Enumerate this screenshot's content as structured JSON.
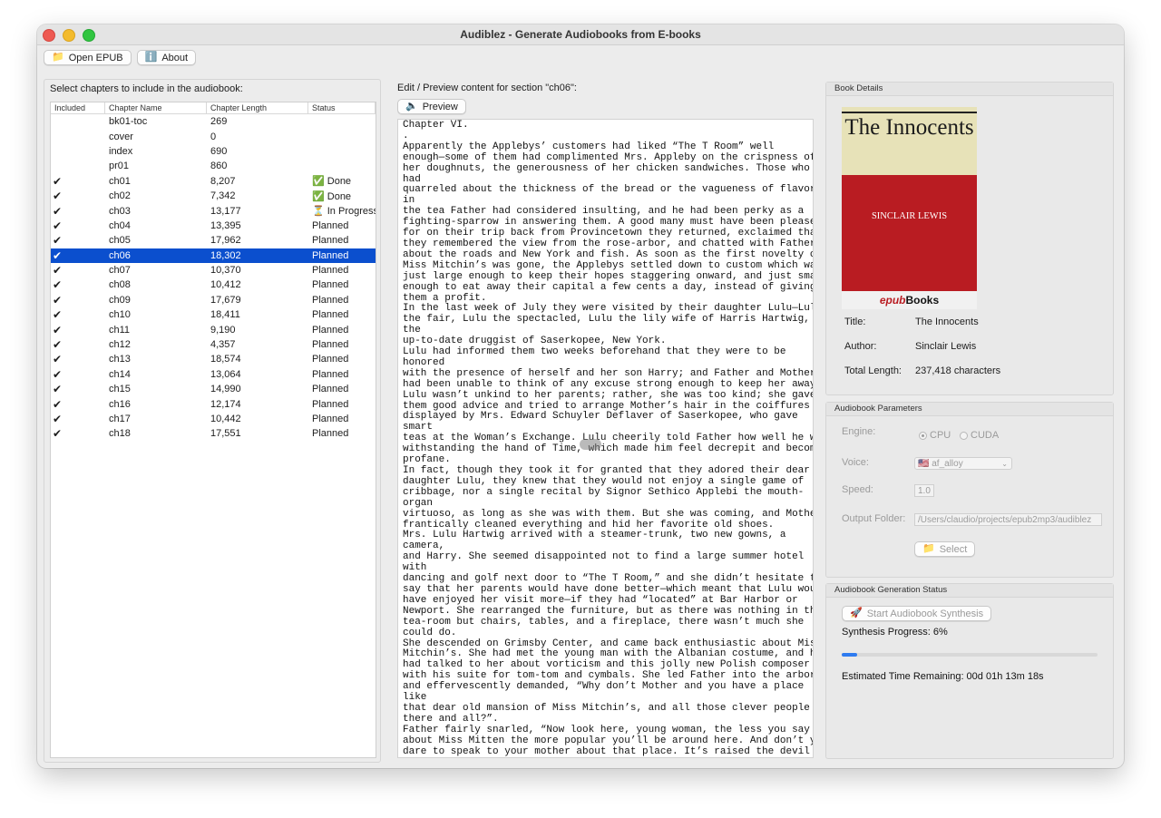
{
  "window": {
    "title": "Audiblez - Generate Audiobooks from E-books"
  },
  "toolbar": {
    "open_label": "Open EPUB",
    "open_icon": "folder-icon",
    "about_label": "About",
    "about_icon": "info-icon"
  },
  "chapters": {
    "prompt": "Select chapters to include in the audiobook:",
    "headers": [
      "Included",
      "Chapter Name",
      "Chapter Length",
      "Status"
    ],
    "rows": [
      {
        "included": "",
        "name": "bk01-toc",
        "length": "269",
        "status": ""
      },
      {
        "included": "",
        "name": "cover",
        "length": "0",
        "status": ""
      },
      {
        "included": "",
        "name": "index",
        "length": "690",
        "status": ""
      },
      {
        "included": "",
        "name": "pr01",
        "length": "860",
        "status": ""
      },
      {
        "included": "✔",
        "name": "ch01",
        "length": "8,207",
        "status": "✅ Done"
      },
      {
        "included": "✔",
        "name": "ch02",
        "length": "7,342",
        "status": "✅ Done"
      },
      {
        "included": "✔",
        "name": "ch03",
        "length": "13,177",
        "status": "⏳ In Progress"
      },
      {
        "included": "✔",
        "name": "ch04",
        "length": "13,395",
        "status": "Planned"
      },
      {
        "included": "✔",
        "name": "ch05",
        "length": "17,962",
        "status": "Planned"
      },
      {
        "included": "✔",
        "name": "ch06",
        "length": "18,302",
        "status": "Planned"
      },
      {
        "included": "✔",
        "name": "ch07",
        "length": "10,370",
        "status": "Planned"
      },
      {
        "included": "✔",
        "name": "ch08",
        "length": "10,412",
        "status": "Planned"
      },
      {
        "included": "✔",
        "name": "ch09",
        "length": "17,679",
        "status": "Planned"
      },
      {
        "included": "✔",
        "name": "ch10",
        "length": "18,411",
        "status": "Planned"
      },
      {
        "included": "✔",
        "name": "ch11",
        "length": "9,190",
        "status": "Planned"
      },
      {
        "included": "✔",
        "name": "ch12",
        "length": "4,357",
        "status": "Planned"
      },
      {
        "included": "✔",
        "name": "ch13",
        "length": "18,574",
        "status": "Planned"
      },
      {
        "included": "✔",
        "name": "ch14",
        "length": "13,064",
        "status": "Planned"
      },
      {
        "included": "✔",
        "name": "ch15",
        "length": "14,990",
        "status": "Planned"
      },
      {
        "included": "✔",
        "name": "ch16",
        "length": "12,174",
        "status": "Planned"
      },
      {
        "included": "✔",
        "name": "ch17",
        "length": "10,442",
        "status": "Planned"
      },
      {
        "included": "✔",
        "name": "ch18",
        "length": "17,551",
        "status": "Planned"
      }
    ],
    "selected_index": 9
  },
  "editor": {
    "label": "Edit / Preview content for section \"ch06\":",
    "preview_label": "Preview",
    "preview_icon": "speaker-icon",
    "content": "Chapter VI.\n.\nApparently the Applebys’ customers had liked “The T Room” well\nenough—some of them had complimented Mrs. Appleby on the crispness of\nher doughnuts, the generousness of her chicken sandwiches. Those who\nhad\nquarreled about the thickness of the bread or the vagueness of flavor\nin\nthe tea Father had considered insulting, and he had been perky as a\nfighting-sparrow in answering them. A good many must have been pleased,\nfor on their trip back from Provincetown they returned, exclaimed that\nthey remembered the view from the rose-arbor, and chatted with Father\nabout the roads and New York and fish. As soon as the first novelty of\nMiss Mitchin’s was gone, the Applebys settled down to custom which was\njust large enough to keep their hopes staggering onward, and just small\nenough to eat away their capital a few cents a day, instead of giving\nthem a profit.\nIn the last week of July they were visited by their daughter Lulu—Lulu\nthe fair, Lulu the spectacled, Lulu the lily wife of Harris Hartwig,\nthe\nup-to-date druggist of Saserkopee, New York.\nLulu had informed them two weeks beforehand that they were to be\nhonored\nwith the presence of herself and her son Harry; and Father and Mother\nhad been unable to think of any excuse strong enough to keep her away.\nLulu wasn’t unkind to her parents; rather, she was too kind; she gave\nthem good advice and tried to arrange Mother’s hair in the coiffures\ndisplayed by Mrs. Edward Schuyler Deflaver of Saserkopee, who gave\nsmart\nteas at the Woman’s Exchange. Lulu cheerily told Father how well he was\nwithstanding the hand of Time, which made him feel decrepit and become\nprofane.\nIn fact, though they took it for granted that they adored their dear\ndaughter Lulu, they knew that they would not enjoy a single game of\ncribbage, nor a single recital by Signor Sethico Applebi the mouth-\norgan\nvirtuoso, as long as she was with them. But she was coming, and Mother\nfrantically cleaned everything and hid her favorite old shoes.\nMrs. Lulu Hartwig arrived with a steamer-trunk, two new gowns, a\ncamera,\nand Harry. She seemed disappointed not to find a large summer hotel\nwith\ndancing and golf next door to “The T Room,” and she didn’t hesitate to\nsay that her parents would have done better—which meant that Lulu would\nhave enjoyed her visit more—if they had “located” at Bar Harbor or\nNewport. She rearranged the furniture, but as there was nothing in the\ntea-room but chairs, tables, and a fireplace, there wasn’t much she\ncould do.\nShe descended on Grimsby Center, and came back enthusiastic about Miss\nMitchin’s. She had met the young man with the Albanian costume, and he\nhad talked to her about vorticism and this jolly new Polish composer\nwith his suite for tom-tom and cymbals. She led Father into the arbor\nand effervescently demanded, “Why don’t Mother and you have a place\nlike\nthat dear old mansion of Miss Mitchin’s, and all those clever people\nthere and all?”.\nFather fairly snarled, “Now look here, young woman, the less you say\nabout Miss Mitten the more popular you’ll be around here. And don’t you\ndare to speak to your mother about that place. It’s raised the devil"
  },
  "book": {
    "group_title": "Book Details",
    "cover": {
      "title": "The Innocents",
      "author": "SINCLAIR LEWIS",
      "publisher_prefix": "epub",
      "publisher_suffix": "Books"
    },
    "title_label": "Title:",
    "title": "The Innocents",
    "author_label": "Author:",
    "author": "Sinclair Lewis",
    "length_label": "Total Length:",
    "length": "237,418 characters"
  },
  "params": {
    "group_title": "Audiobook Parameters",
    "engine_label": "Engine:",
    "engine_options": [
      "CPU",
      "CUDA"
    ],
    "engine_selected": "CPU",
    "voice_label": "Voice:",
    "voice_value": "🇺🇸 af_alloy",
    "speed_label": "Speed:",
    "speed_value": "1.0",
    "output_label": "Output Folder:",
    "output_value": "/Users/claudio/projects/epub2mp3/audiblez",
    "select_label": "Select",
    "select_icon": "folder-icon"
  },
  "status": {
    "group_title": "Audiobook Generation Status",
    "start_label": "Start Audiobook Synthesis",
    "start_icon": "rocket-icon",
    "progress_text": "Synthesis Progress: 6%",
    "progress": 0.06,
    "eta_text": "Estimated Time Remaining: 00d 01h 13m 18s"
  },
  "colors": {
    "selection": "#0b4fce",
    "accent": "#2e7bf0",
    "cover_red": "#b91c22",
    "cover_cream": "#e7e2b8"
  }
}
